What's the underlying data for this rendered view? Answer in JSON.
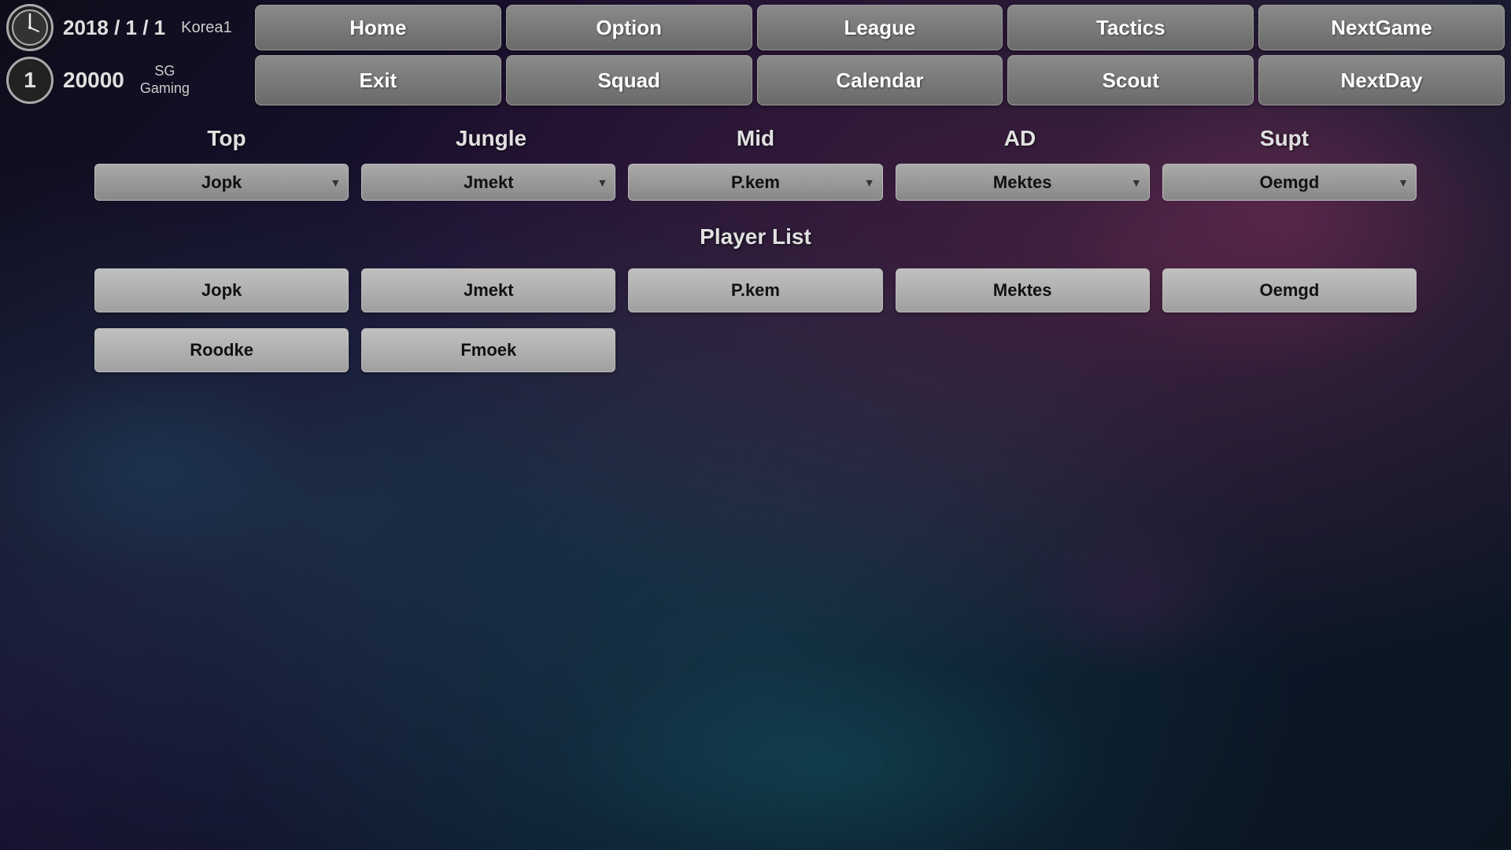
{
  "header": {
    "date": "2018 / 1 / 1",
    "region": "Korea1",
    "balance": "20000",
    "rank": "1",
    "team_line1": "SG",
    "team_line2": "Gaming"
  },
  "nav_row1": {
    "home": "Home",
    "option": "Option",
    "league": "League",
    "tactics": "Tactics",
    "nextgame": "NextGame"
  },
  "nav_row2": {
    "exit": "Exit",
    "squad": "Squad",
    "calendar": "Calendar",
    "scout": "Scout",
    "nextday": "NextDay"
  },
  "positions": {
    "top": "Top",
    "jungle": "Jungle",
    "mid": "Mid",
    "ad": "AD",
    "supt": "Supt"
  },
  "selected_players": {
    "top": "Jopk",
    "jungle": "Jmekt",
    "mid": "P.kem",
    "ad": "Mektes",
    "supt": "Oemgd"
  },
  "player_list_title": "Player List",
  "players_row1": [
    "Jopk",
    "Jmekt",
    "P.kem",
    "Mektes",
    "Oemgd"
  ],
  "players_row2": [
    "Roodke",
    "Fmoek",
    "",
    "",
    ""
  ]
}
